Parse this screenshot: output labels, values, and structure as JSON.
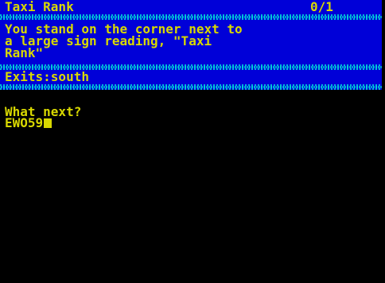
{
  "header": {
    "location": "Taxi Rank",
    "score": "0/1"
  },
  "description": {
    "lines": [
      "You stand on the corner next to",
      "a large sign reading, \"Taxi",
      "Rank\""
    ]
  },
  "exits": {
    "text": "Exits:south"
  },
  "prompt": {
    "question": "What next?",
    "input_value": "EWO59"
  },
  "colors": {
    "background": "#000000",
    "panel": "#0000d8",
    "text": "#d8d800",
    "divider": "#00b8d8"
  }
}
